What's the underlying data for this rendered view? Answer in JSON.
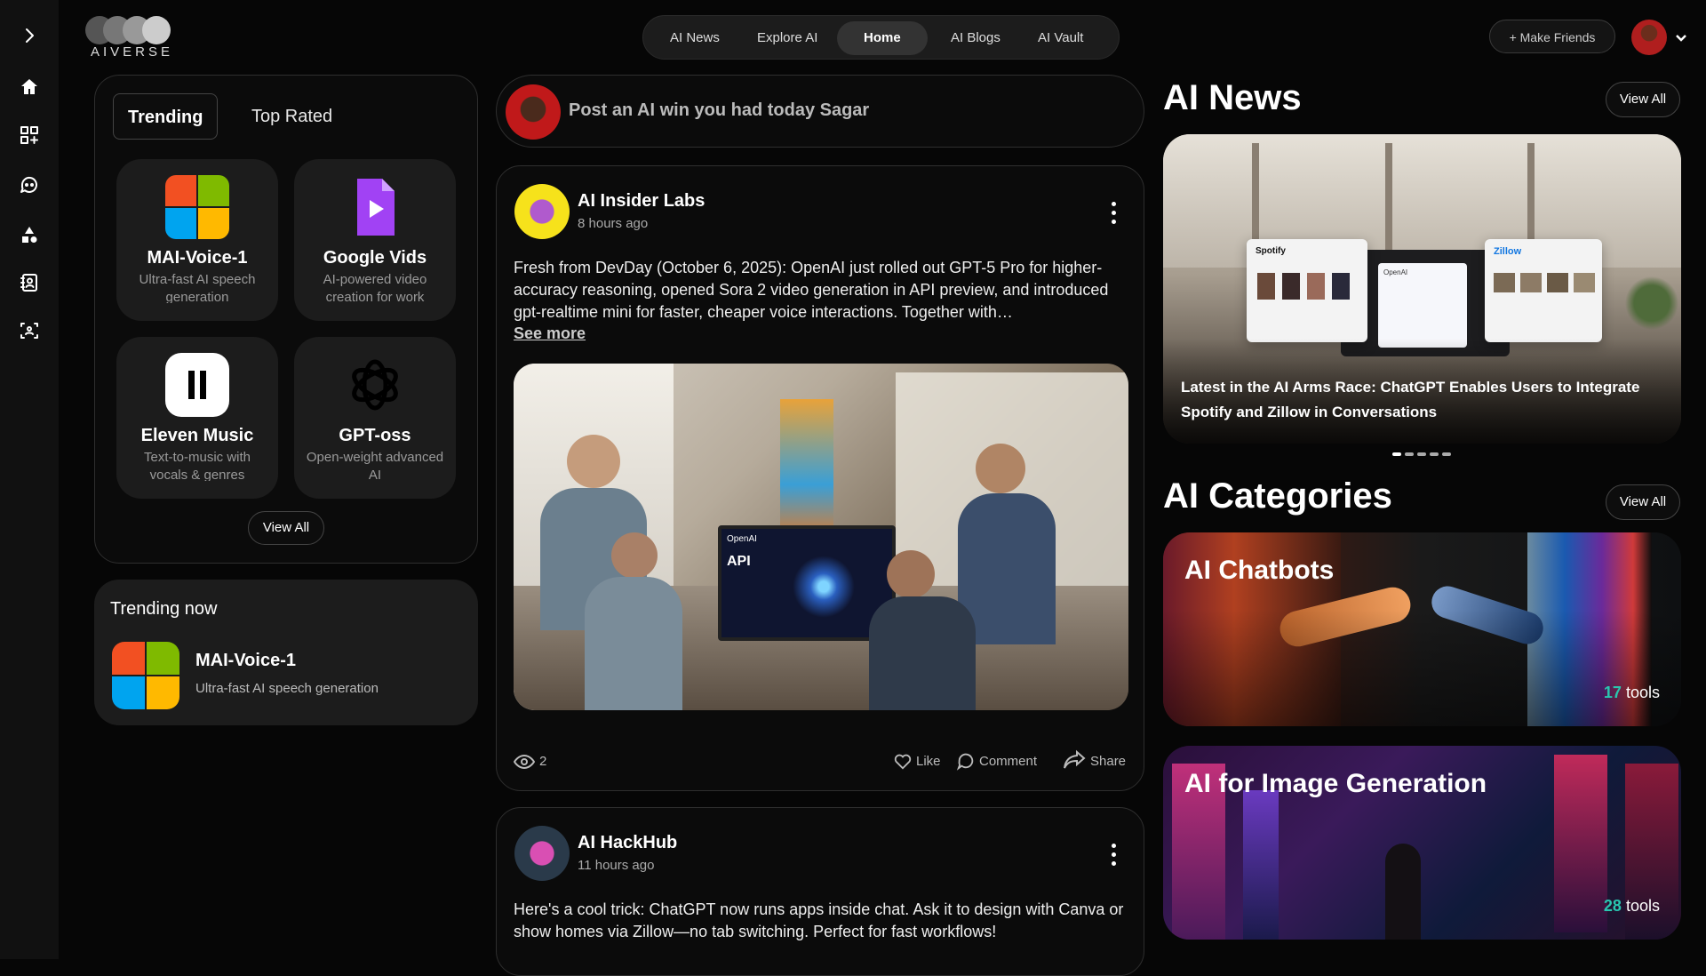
{
  "brand": {
    "logo_text": "AIVERSE"
  },
  "topnav": {
    "items": [
      "AI News",
      "Explore AI",
      "Home",
      "AI Blogs",
      "AI Vault"
    ],
    "active": "Home"
  },
  "header": {
    "make_friends": "+ Make Friends"
  },
  "sidebar": {
    "icons": [
      "chevron-right-icon",
      "home-icon",
      "grid-plus-icon",
      "chat-bot-icon",
      "shapes-icon",
      "contact-book-icon",
      "group-scan-icon"
    ]
  },
  "left": {
    "tabs": {
      "trending": "Trending",
      "top_rated": "Top Rated"
    },
    "cards": [
      {
        "name": "MAI-Voice-1",
        "desc": "Ultra-fast AI speech generation",
        "icon": "microsoft-logo-icon"
      },
      {
        "name": "Google Vids",
        "desc": "AI-powered video creation for work",
        "icon": "google-vids-icon"
      },
      {
        "name": "Eleven Music",
        "desc": "Text-to-music with vocals & genres",
        "icon": "elevenlabs-icon"
      },
      {
        "name": "GPT-oss",
        "desc": "Open-weight advanced AI",
        "icon": "openai-logo-icon"
      }
    ],
    "view_all": "View All",
    "trending_now": {
      "title": "Trending now",
      "name": "MAI-Voice-1",
      "desc": "Ultra-fast AI speech generation"
    }
  },
  "composer": {
    "placeholder": "Post an AI win you had today Sagar"
  },
  "posts": [
    {
      "author": "AI Insider Labs",
      "time": "8 hours ago",
      "text": "Fresh from DevDay (October 6, 2025): OpenAI just rolled out GPT-5 Pro for higher-accuracy reasoning, opened Sora 2 video generation in API preview, and introduced gpt-realtime mini for faster, cheaper voice interactions. Together with…",
      "see_more": "See more",
      "image_caption_api": "API",
      "image_caption_openai": "OpenAI",
      "views": "2",
      "like": "Like",
      "comment": "Comment",
      "share": "Share"
    },
    {
      "author": "AI HackHub",
      "time": "11 hours ago",
      "text": "Here's a cool trick: ChatGPT now runs apps inside chat. Ask it to design with Canva or show homes via Zillow—no tab switching. Perfect for fast workflows!"
    }
  ],
  "news": {
    "title": "AI News",
    "view_all": "View All",
    "headline": "Latest in the AI Arms Race: ChatGPT Enables Users to Integrate Spotify and Zillow in Conversations",
    "spotify_label": "Spotify",
    "zillow_label": "Zillow",
    "openai_label": "OpenAI",
    "dots": 5,
    "active_dot": 0
  },
  "categories": {
    "title": "AI Categories",
    "view_all": "View All",
    "items": [
      {
        "name": "AI Chatbots",
        "count": "17",
        "unit": "tools"
      },
      {
        "name": "AI for Image Generation",
        "count": "28",
        "unit": "tools"
      }
    ]
  },
  "colors": {
    "accent_teal": "#29c6b0",
    "bg": "#060606",
    "card": "#1c1c1c"
  }
}
